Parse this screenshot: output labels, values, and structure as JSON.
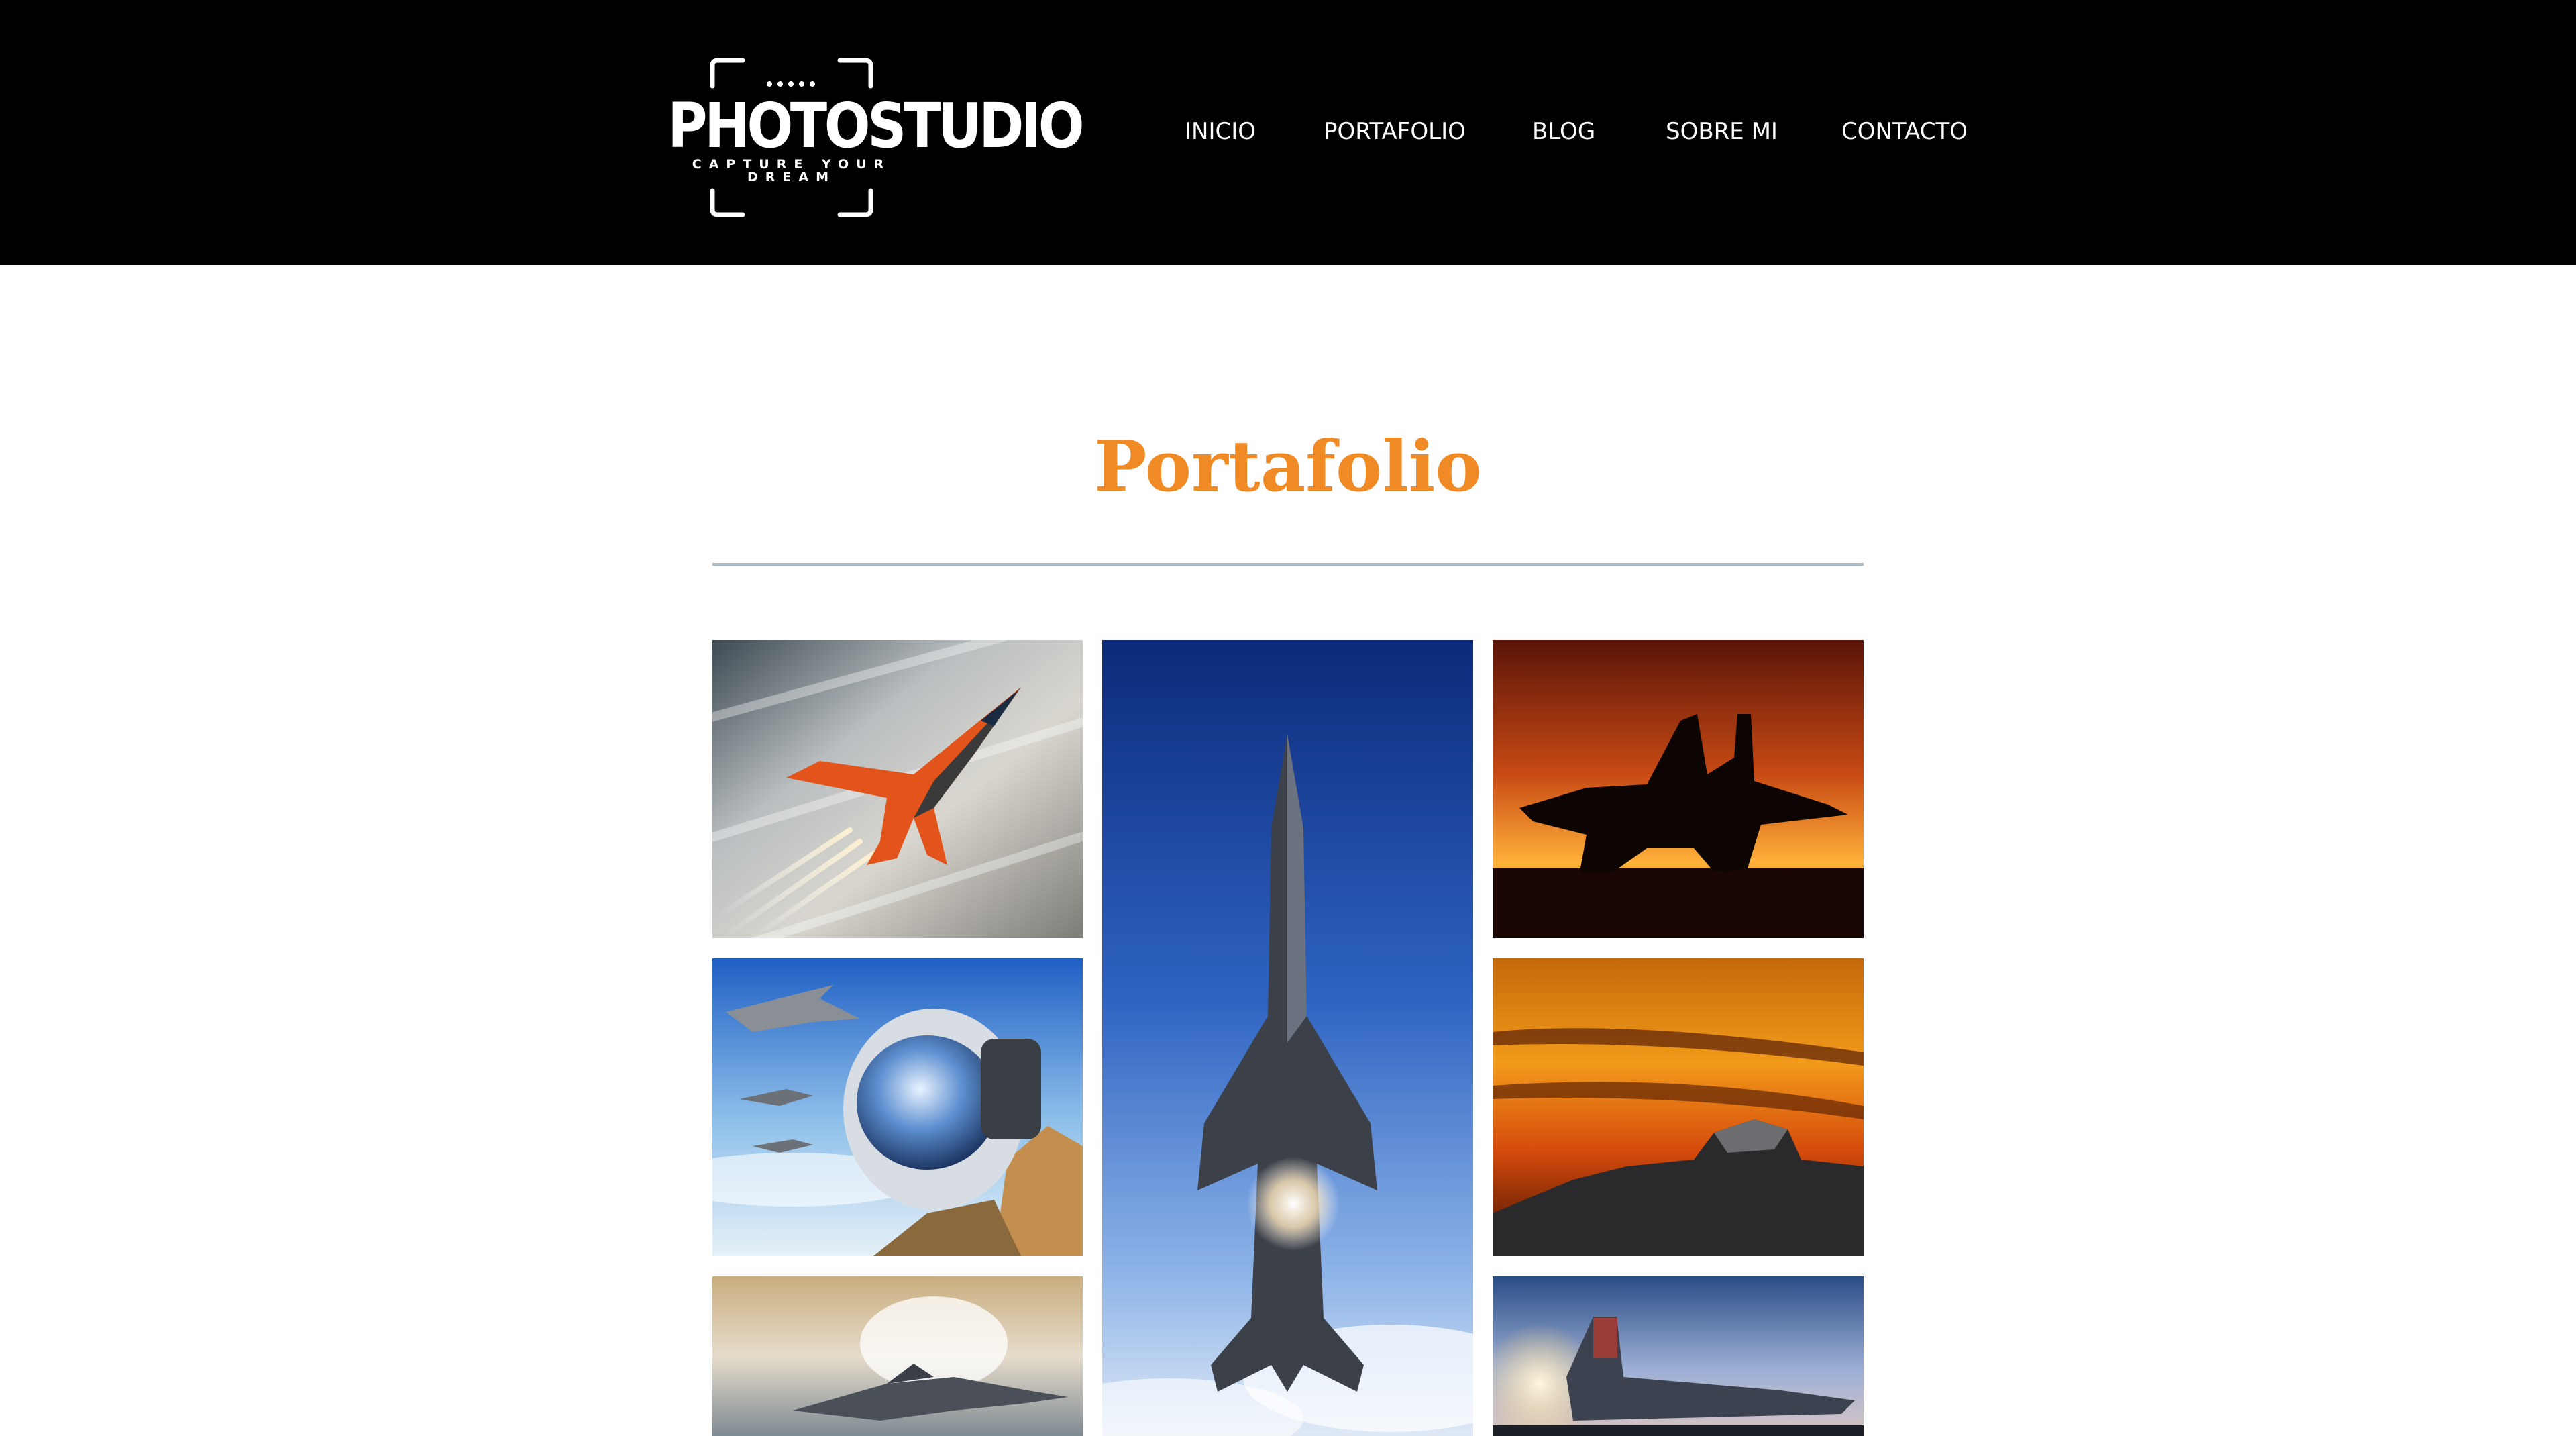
{
  "logo": {
    "title": "PHOTOSTUDIO",
    "tagline": "CAPTURE YOUR DREAM"
  },
  "nav": {
    "items": [
      {
        "label": "INICIO"
      },
      {
        "label": "PORTAFOLIO"
      },
      {
        "label": "BLOG"
      },
      {
        "label": "SOBRE MI"
      },
      {
        "label": "CONTACTO"
      }
    ]
  },
  "main": {
    "title": "Portafolio"
  },
  "colors": {
    "header_bg": "#000000",
    "accent": "#f08a24",
    "divider": "#a9bccb",
    "page_bg": "#ffffff"
  },
  "gallery": {
    "photos": [
      {
        "subject": "orange-fighter-jet-banking"
      },
      {
        "subject": "fighter-jet-vertical-climb-blue-sky"
      },
      {
        "subject": "jet-silhouette-sunset"
      },
      {
        "subject": "pilot-helmet-formation"
      },
      {
        "subject": "orange-sky-cockpit-silhouette"
      },
      {
        "subject": "jet-vapor-cone-low-pass"
      },
      {
        "subject": "carrier-jet-afterburner-dusk"
      }
    ]
  }
}
